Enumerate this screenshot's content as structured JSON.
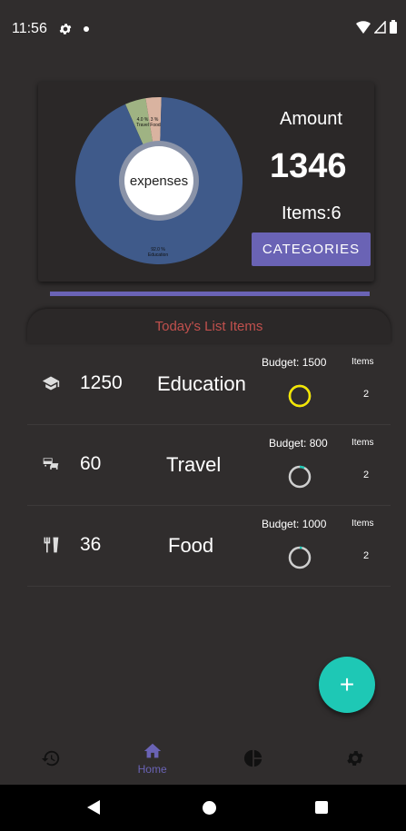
{
  "status_bar": {
    "time": "11:56"
  },
  "summary": {
    "amount_label": "Amount",
    "amount_value": "1346",
    "items_count": "Items:6",
    "categories_button": "CATEGORIES",
    "donut_center_label": "expenses",
    "donut_slices": [
      {
        "label": "Education",
        "percent_text": "92.0 %",
        "value": 92.0,
        "color": "#3f5a8a"
      },
      {
        "label": "Travel",
        "percent_text": "4.0 %",
        "value": 4.0,
        "color": "#9fb383"
      },
      {
        "label": "Food",
        "percent_text": "3 %",
        "value": 3.0,
        "color": "#d9b3a0"
      }
    ]
  },
  "list_header": "Today's List Items",
  "items": [
    {
      "icon": "graduation-cap-icon",
      "amount": "1250",
      "category": "Education",
      "budget": "Budget: 1500",
      "items_label": "Items",
      "items_count": "2",
      "ring_color": "#f2e600",
      "ring_fraction": 1.0
    },
    {
      "icon": "bus-car-icon",
      "amount": "60",
      "category": "Travel",
      "budget": "Budget: 800",
      "items_label": "Items",
      "items_count": "2",
      "ring_color": "#1ec8b5",
      "ring_fraction": 0.075
    },
    {
      "icon": "utensils-icon",
      "amount": "36",
      "category": "Food",
      "budget": "Budget: 1000",
      "items_label": "Items",
      "items_count": "2",
      "ring_color": "#1ec8b5",
      "ring_fraction": 0.036
    }
  ],
  "fab": {
    "label": "+"
  },
  "bottom_nav": [
    {
      "icon": "history-icon",
      "label": ""
    },
    {
      "icon": "home-icon",
      "label": "Home",
      "active": true
    },
    {
      "icon": "pie-chart-icon",
      "label": ""
    },
    {
      "icon": "settings-icon",
      "label": ""
    }
  ],
  "colors": {
    "accent": "#6a63b5",
    "fab": "#1ec8b5",
    "header_text": "#c0504d",
    "background": "#302d2d"
  }
}
